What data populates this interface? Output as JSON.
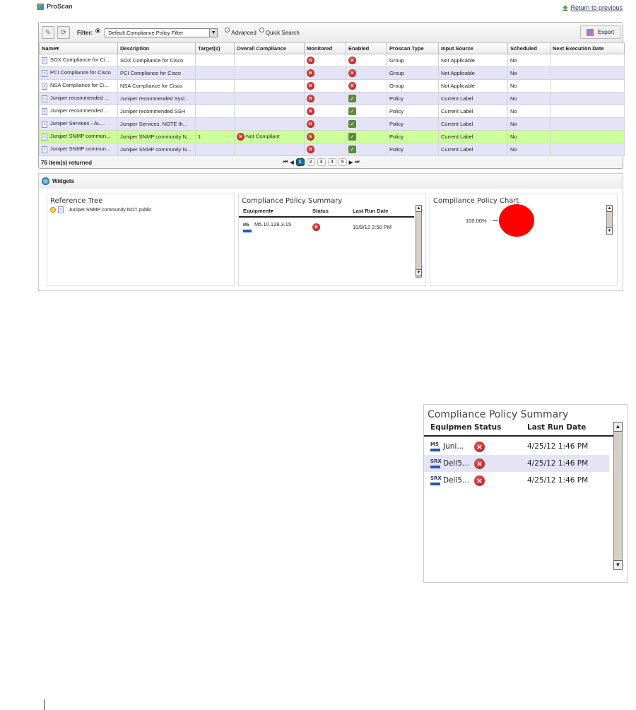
{
  "app": {
    "title": "ProScan",
    "return_link": "Return to previous"
  },
  "toolbar": {
    "filter_label": "Filter:",
    "filter_value": "Default Compliance Policy Filter",
    "advanced": "Advanced",
    "quick_search": "Quick Search",
    "export": "Export"
  },
  "table": {
    "columns": [
      "Name▾",
      "Description",
      "Target(s)",
      "Overall Compliance",
      "Monitored",
      "Enabled",
      "Proscan Type",
      "Input Source",
      "Scheduled",
      "Next Execution Date"
    ],
    "rows": [
      {
        "name": "SOX Compliance for Ci...",
        "description": "SOX Compliance for Cisco",
        "targets": "",
        "overall": "",
        "monitored": false,
        "enabled": false,
        "type": "Group",
        "input": "Not Applicable",
        "scheduled": "No",
        "next": ""
      },
      {
        "name": "PCI Compliance for Cisco",
        "description": "PCI Compliance for Cisco",
        "targets": "",
        "overall": "",
        "monitored": false,
        "enabled": false,
        "type": "Group",
        "input": "Not Applicable",
        "scheduled": "No",
        "next": ""
      },
      {
        "name": "NSA Compliance for Ci...",
        "description": "NSA Compliance for Cisco",
        "targets": "",
        "overall": "",
        "monitored": false,
        "enabled": false,
        "type": "Group",
        "input": "Not Applicable",
        "scheduled": "No",
        "next": ""
      },
      {
        "name": "Juniper recommended ...",
        "description": "Juniper recommended Sysl...",
        "targets": "",
        "overall": "",
        "monitored": false,
        "enabled": true,
        "type": "Policy",
        "input": "Current Label",
        "scheduled": "No",
        "next": ""
      },
      {
        "name": "Juniper recommended ...",
        "description": "Juniper recommended SSH",
        "targets": "",
        "overall": "",
        "monitored": false,
        "enabled": true,
        "type": "Policy",
        "input": "Current Label",
        "scheduled": "No",
        "next": ""
      },
      {
        "name": "Juniper Services - AL...",
        "description": "Juniper Services. NOTE th...",
        "targets": "",
        "overall": "",
        "monitored": false,
        "enabled": true,
        "type": "Policy",
        "input": "Current Label",
        "scheduled": "No",
        "next": ""
      },
      {
        "name": "Juniper SNMP commun...",
        "description": "Juniper SNMP community N...",
        "targets": "1",
        "overall": "Not Compliant",
        "monitored": false,
        "enabled": true,
        "type": "Policy",
        "input": "Current Label",
        "scheduled": "No",
        "next": "",
        "selected": true
      },
      {
        "name": "Juniper SNMP commun...",
        "description": "Juniper SNMP community N...",
        "targets": "",
        "overall": "",
        "monitored": false,
        "enabled": true,
        "type": "Policy",
        "input": "Current Label",
        "scheduled": "No",
        "next": ""
      }
    ],
    "count": "76 item(s) returned",
    "pages": [
      "1",
      "2",
      "3",
      "4",
      "5"
    ],
    "current_page": "1"
  },
  "widgets": {
    "title": "Widgets",
    "reference_tree": {
      "title": "Reference Tree",
      "item": "Juniper SNMP community NOT public"
    },
    "summary": {
      "title": "Compliance Policy Summary",
      "columns": [
        "Equipment▾",
        "Status",
        "Last Run Date"
      ],
      "rows": [
        {
          "badge": "M5",
          "equipment": "M5.10.128.3.15",
          "date": "10/9/12 2:50 PM"
        }
      ]
    },
    "chart": {
      "title": "Compliance Policy Chart",
      "label": "100.00%",
      "color": "#ff0000"
    }
  },
  "detail_summary": {
    "title": "Compliance Policy Summary",
    "columns": [
      "Equipmen",
      "Status",
      "Last Run Date"
    ],
    "rows": [
      {
        "badge": "M5",
        "equipment": "Juni...",
        "date": "4/25/12 1:46 PM"
      },
      {
        "badge": "SRX",
        "equipment": "Dell5...",
        "date": "4/25/12 1:46 PM"
      },
      {
        "badge": "SRX",
        "equipment": "Dell5...",
        "date": "4/25/12 1:46 PM"
      }
    ]
  },
  "chart_data": {
    "type": "pie",
    "title": "Compliance Policy Chart",
    "values": [
      100
    ],
    "labels": [
      "100.00%"
    ],
    "colors": [
      "#ff0000"
    ]
  }
}
